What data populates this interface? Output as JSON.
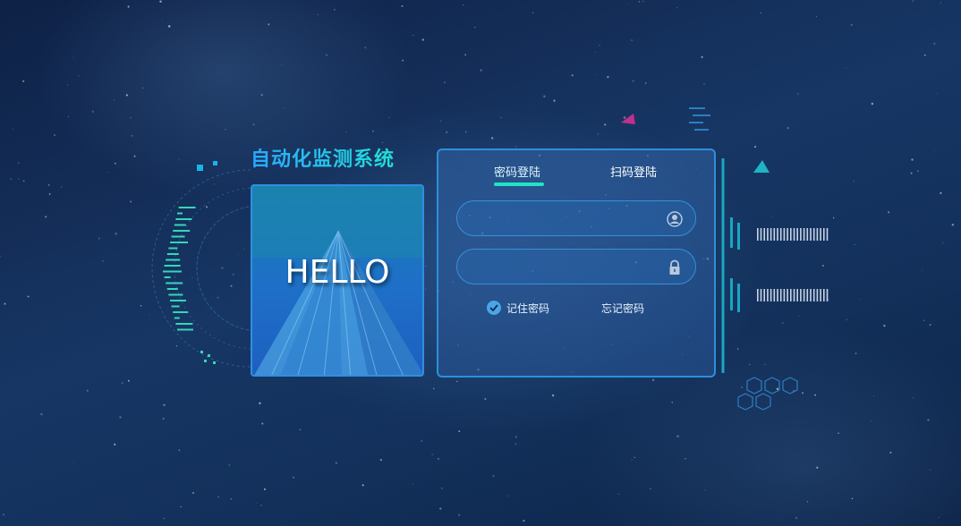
{
  "system_title": "自动化监测系统",
  "hello_card": {
    "text": "HELLO"
  },
  "login": {
    "tabs": [
      {
        "label": "密码登陆",
        "active": true
      },
      {
        "label": "扫码登陆",
        "active": false
      }
    ],
    "username": {
      "value": "",
      "placeholder": "",
      "icon": "user-icon"
    },
    "password": {
      "value": "",
      "placeholder": "",
      "icon": "lock-icon"
    },
    "remember_label": "记住密码",
    "remember_checked": true,
    "forgot_label": "忘记密码"
  },
  "colors": {
    "background": "#173664",
    "accent_cyan": "#22e3c4",
    "border_blue": "#2d8fdc",
    "title_gradient_start": "#2aa7ff",
    "title_gradient_end": "#22e0d6",
    "triangle_magenta": "#c02f8f",
    "triangle_teal": "#1fb3c4"
  }
}
